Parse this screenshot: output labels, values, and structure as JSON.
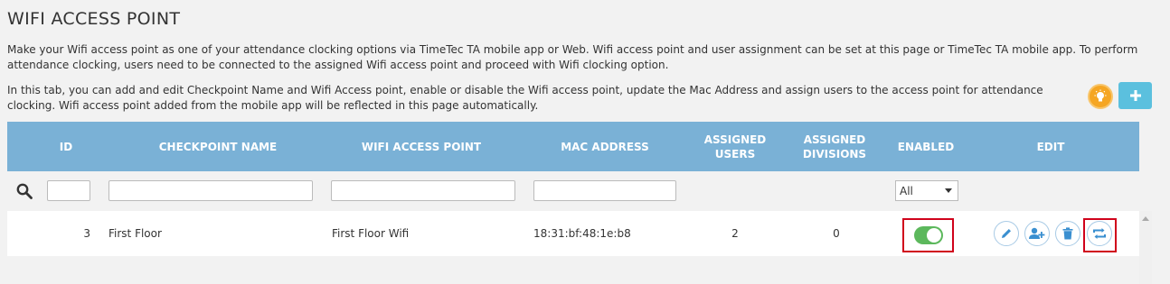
{
  "page": {
    "title": "WIFI ACCESS POINT",
    "description_1": "Make your Wifi access point as one of your attendance clocking options via TimeTec TA mobile app or Web. Wifi access point and user assignment can be set at this page or TimeTec TA mobile app. To perform attendance clocking, users need to be connected to the assigned Wifi access point and proceed with Wifi clocking option.",
    "description_2": "In this tab, you can add and edit Checkpoint Name and Wifi Access point, enable or disable the Wifi access point, update the Mac Address and assign users to the access point for attendance clocking. Wifi access point added from the mobile app will be reflected in this page automatically."
  },
  "table": {
    "headers": {
      "id": "ID",
      "checkpoint_name": "CHECKPOINT NAME",
      "wifi_access_point": "WIFI ACCESS POINT",
      "mac_address": "MAC ADDRESS",
      "assigned_users": "ASSIGNED USERS",
      "assigned_divisions": "ASSIGNED DIVISIONS",
      "enabled": "ENABLED",
      "edit": "EDIT"
    },
    "filters": {
      "enabled_select_value": "All"
    },
    "rows": [
      {
        "id": "3",
        "checkpoint_name": "First Floor",
        "wifi_access_point": "First Floor Wifi",
        "mac_address": "18:31:bf:48:1e:b8",
        "assigned_users": "2",
        "assigned_divisions": "0",
        "enabled": true
      }
    ]
  },
  "icons": [
    "search-icon",
    "lightbulb-icon",
    "plus-icon",
    "pencil-icon",
    "add-user-icon",
    "trash-icon",
    "sync-icon"
  ],
  "colors": {
    "header_bg": "#7ab1d6",
    "toggle_on": "#5cb85c",
    "add_button": "#5bc0de",
    "tip_button": "#f5a623",
    "highlight_box": "#d0021b",
    "action_icon": "#3a8fd0"
  }
}
